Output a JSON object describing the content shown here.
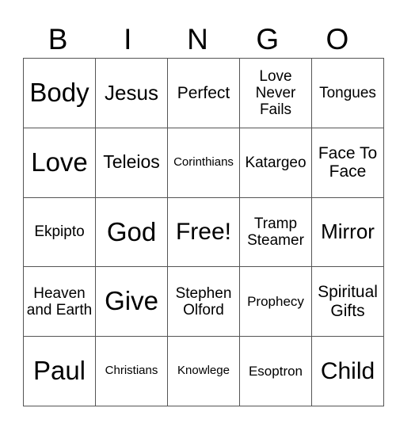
{
  "header": [
    "B",
    "I",
    "N",
    "G",
    "O"
  ],
  "rows": [
    [
      "Body",
      "Jesus",
      "Perfect",
      "Love Never Fails",
      "Tongues"
    ],
    [
      "Love",
      "Teleios",
      "Corinthians",
      "Katargeo",
      "Face To Face"
    ],
    [
      "Ekpipto",
      "God",
      "Free!",
      "Tramp Steamer",
      "Mirror"
    ],
    [
      "Heaven and Earth",
      "Give",
      "Stephen Olford",
      "Prophecy",
      "Spiritual Gifts"
    ],
    [
      "Paul",
      "Christians",
      "Knowlege",
      "Esoptron",
      "Child"
    ]
  ]
}
